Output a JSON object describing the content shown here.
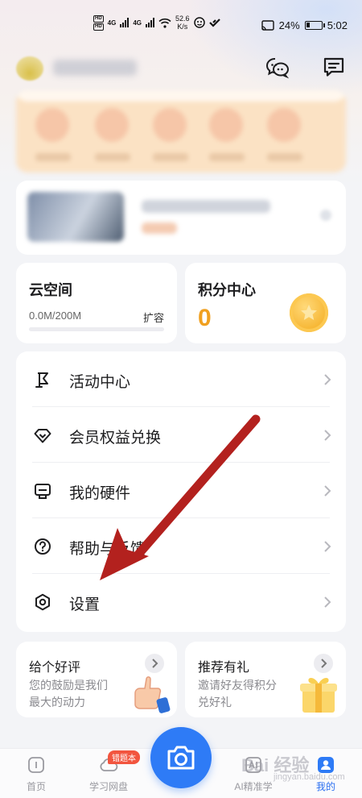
{
  "status_bar": {
    "hd1": "HD",
    "hd2": "HD",
    "net1": "4G",
    "net2": "4G",
    "speed_value": "52.6",
    "speed_unit": "K/s",
    "battery_percent": "24%",
    "battery_level": 0.24,
    "time": "5:02"
  },
  "header": {
    "chat_icon": "chat-bubbles-icon",
    "message_icon": "message-icon"
  },
  "cloud_space": {
    "title": "云空间",
    "usage": "0.0M/200M",
    "usage_fraction": 0.0,
    "expand_label": "扩容"
  },
  "points_center": {
    "title": "积分中心",
    "value": "0"
  },
  "menu": [
    {
      "label": "活动中心",
      "icon": "flag-icon"
    },
    {
      "label": "会员权益兑换",
      "icon": "diamond-icon"
    },
    {
      "label": "我的硬件",
      "icon": "device-icon"
    },
    {
      "label": "帮助与反馈",
      "icon": "help-icon"
    },
    {
      "label": "设置",
      "icon": "settings-icon"
    }
  ],
  "promos": {
    "review": {
      "title": "给个好评",
      "subtitle": "您的鼓励是我们最大的动力"
    },
    "referral": {
      "title": "推荐有礼",
      "subtitle": "邀请好友得积分兑好礼"
    }
  },
  "bottom_nav": {
    "items": [
      {
        "label": "首页",
        "icon": "home-icon"
      },
      {
        "label": "学习网盘",
        "icon": "cloud-icon",
        "badge": "错题本"
      },
      {
        "label": "AI精准学",
        "icon": "ai-icon"
      },
      {
        "label": "我的",
        "icon": "profile-icon",
        "active": true
      }
    ],
    "camera_icon": "camera-icon"
  },
  "watermark": {
    "text": "Bai 经验",
    "sub": "jingyan.baidu.com"
  },
  "colors": {
    "accent": "#2e7bf6",
    "points": "#f0a020",
    "badge": "#f2553f",
    "arrow": "#b3211e"
  }
}
